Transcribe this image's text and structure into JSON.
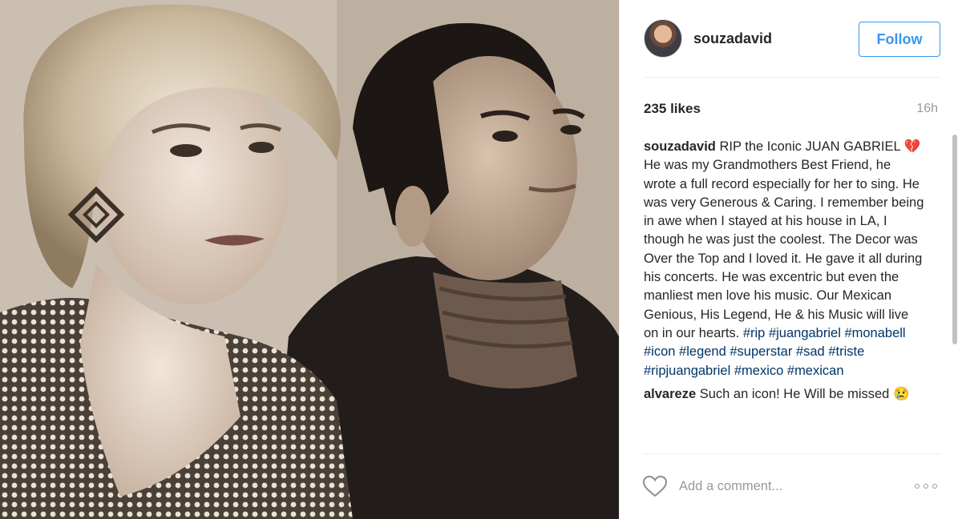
{
  "post": {
    "username": "souzadavid",
    "follow_label": "Follow",
    "likes": "235 likes",
    "time": "16h"
  },
  "caption": {
    "username": "souzadavid",
    "text": "RIP the Iconic JUAN GABRIEL",
    "emoji": "💔",
    "text2": "He was my Grandmothers Best Friend, he wrote a full record especially for her to sing. He was very Generous & Caring. I remember being in awe when I stayed at his house in LA, I though he was just the coolest. The Decor was Over the Top and I loved it. He gave it all during his concerts. He was excentric but even the manliest men love his music. Our Mexican Genious, His Legend, He & his Music will live on in our hearts.",
    "hashtags": [
      "#rip",
      "#juangabriel",
      "#monabell",
      "#icon",
      "#legend",
      "#superstar",
      "#sad",
      "#triste",
      "#ripjuangabriel",
      "#mexico",
      "#mexican"
    ]
  },
  "comment": {
    "username": "alvareze",
    "text": "Such an icon! He Will be missed",
    "emoji": "😢"
  },
  "composer": {
    "placeholder": "Add a comment..."
  },
  "icons": {
    "like": "heart-outline-icon",
    "more": "more-options-icon"
  },
  "colors": {
    "accent": "#3897f0",
    "hashtag": "#003569",
    "muted": "#999999"
  }
}
